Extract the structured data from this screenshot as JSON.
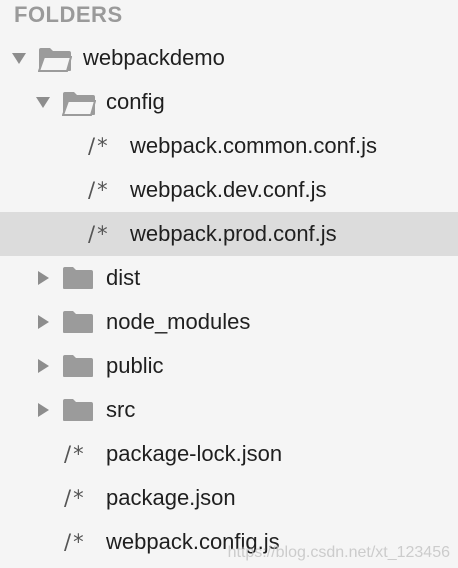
{
  "sidebar": {
    "header": "FOLDERS",
    "file_icon_glyph": "/*",
    "items": [
      {
        "label": "webpackdemo",
        "type": "folder",
        "expanded": true,
        "icon": "folder-open-icon"
      },
      {
        "label": "config",
        "type": "folder",
        "expanded": true,
        "icon": "folder-open-icon"
      },
      {
        "label": "webpack.common.conf.js",
        "type": "file",
        "icon": "js-file-icon"
      },
      {
        "label": "webpack.dev.conf.js",
        "type": "file",
        "icon": "js-file-icon"
      },
      {
        "label": "webpack.prod.conf.js",
        "type": "file",
        "icon": "js-file-icon",
        "selected": true
      },
      {
        "label": "dist",
        "type": "folder",
        "expanded": false,
        "icon": "folder-icon"
      },
      {
        "label": "node_modules",
        "type": "folder",
        "expanded": false,
        "icon": "folder-icon"
      },
      {
        "label": "public",
        "type": "folder",
        "expanded": false,
        "icon": "folder-icon"
      },
      {
        "label": "src",
        "type": "folder",
        "expanded": false,
        "icon": "folder-icon"
      },
      {
        "label": "package-lock.json",
        "type": "file",
        "icon": "json-file-icon"
      },
      {
        "label": "package.json",
        "type": "file",
        "icon": "json-file-icon"
      },
      {
        "label": "webpack.config.js",
        "type": "file",
        "icon": "js-file-icon"
      }
    ]
  },
  "watermark": "https://blog.csdn.net/xt_123456",
  "colors": {
    "selected_row": "#dcdcdc",
    "background": "#f5f5f5",
    "icon_gray": "#8d8d8d"
  }
}
